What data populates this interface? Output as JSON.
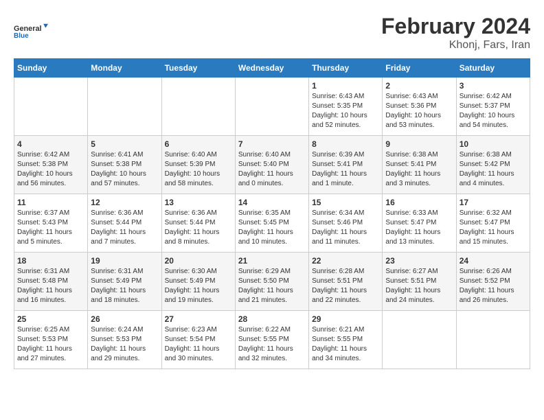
{
  "app": {
    "logo_line1": "General",
    "logo_line2": "Blue"
  },
  "title": "February 2024",
  "subtitle": "Khonj, Fars, Iran",
  "weekdays": [
    "Sunday",
    "Monday",
    "Tuesday",
    "Wednesday",
    "Thursday",
    "Friday",
    "Saturday"
  ],
  "weeks": [
    [
      {
        "day": "",
        "info": ""
      },
      {
        "day": "",
        "info": ""
      },
      {
        "day": "",
        "info": ""
      },
      {
        "day": "",
        "info": ""
      },
      {
        "day": "1",
        "info": "Sunrise: 6:43 AM\nSunset: 5:35 PM\nDaylight: 10 hours\nand 52 minutes."
      },
      {
        "day": "2",
        "info": "Sunrise: 6:43 AM\nSunset: 5:36 PM\nDaylight: 10 hours\nand 53 minutes."
      },
      {
        "day": "3",
        "info": "Sunrise: 6:42 AM\nSunset: 5:37 PM\nDaylight: 10 hours\nand 54 minutes."
      }
    ],
    [
      {
        "day": "4",
        "info": "Sunrise: 6:42 AM\nSunset: 5:38 PM\nDaylight: 10 hours\nand 56 minutes."
      },
      {
        "day": "5",
        "info": "Sunrise: 6:41 AM\nSunset: 5:38 PM\nDaylight: 10 hours\nand 57 minutes."
      },
      {
        "day": "6",
        "info": "Sunrise: 6:40 AM\nSunset: 5:39 PM\nDaylight: 10 hours\nand 58 minutes."
      },
      {
        "day": "7",
        "info": "Sunrise: 6:40 AM\nSunset: 5:40 PM\nDaylight: 11 hours\nand 0 minutes."
      },
      {
        "day": "8",
        "info": "Sunrise: 6:39 AM\nSunset: 5:41 PM\nDaylight: 11 hours\nand 1 minute."
      },
      {
        "day": "9",
        "info": "Sunrise: 6:38 AM\nSunset: 5:41 PM\nDaylight: 11 hours\nand 3 minutes."
      },
      {
        "day": "10",
        "info": "Sunrise: 6:38 AM\nSunset: 5:42 PM\nDaylight: 11 hours\nand 4 minutes."
      }
    ],
    [
      {
        "day": "11",
        "info": "Sunrise: 6:37 AM\nSunset: 5:43 PM\nDaylight: 11 hours\nand 5 minutes."
      },
      {
        "day": "12",
        "info": "Sunrise: 6:36 AM\nSunset: 5:44 PM\nDaylight: 11 hours\nand 7 minutes."
      },
      {
        "day": "13",
        "info": "Sunrise: 6:36 AM\nSunset: 5:44 PM\nDaylight: 11 hours\nand 8 minutes."
      },
      {
        "day": "14",
        "info": "Sunrise: 6:35 AM\nSunset: 5:45 PM\nDaylight: 11 hours\nand 10 minutes."
      },
      {
        "day": "15",
        "info": "Sunrise: 6:34 AM\nSunset: 5:46 PM\nDaylight: 11 hours\nand 11 minutes."
      },
      {
        "day": "16",
        "info": "Sunrise: 6:33 AM\nSunset: 5:47 PM\nDaylight: 11 hours\nand 13 minutes."
      },
      {
        "day": "17",
        "info": "Sunrise: 6:32 AM\nSunset: 5:47 PM\nDaylight: 11 hours\nand 15 minutes."
      }
    ],
    [
      {
        "day": "18",
        "info": "Sunrise: 6:31 AM\nSunset: 5:48 PM\nDaylight: 11 hours\nand 16 minutes."
      },
      {
        "day": "19",
        "info": "Sunrise: 6:31 AM\nSunset: 5:49 PM\nDaylight: 11 hours\nand 18 minutes."
      },
      {
        "day": "20",
        "info": "Sunrise: 6:30 AM\nSunset: 5:49 PM\nDaylight: 11 hours\nand 19 minutes."
      },
      {
        "day": "21",
        "info": "Sunrise: 6:29 AM\nSunset: 5:50 PM\nDaylight: 11 hours\nand 21 minutes."
      },
      {
        "day": "22",
        "info": "Sunrise: 6:28 AM\nSunset: 5:51 PM\nDaylight: 11 hours\nand 22 minutes."
      },
      {
        "day": "23",
        "info": "Sunrise: 6:27 AM\nSunset: 5:51 PM\nDaylight: 11 hours\nand 24 minutes."
      },
      {
        "day": "24",
        "info": "Sunrise: 6:26 AM\nSunset: 5:52 PM\nDaylight: 11 hours\nand 26 minutes."
      }
    ],
    [
      {
        "day": "25",
        "info": "Sunrise: 6:25 AM\nSunset: 5:53 PM\nDaylight: 11 hours\nand 27 minutes."
      },
      {
        "day": "26",
        "info": "Sunrise: 6:24 AM\nSunset: 5:53 PM\nDaylight: 11 hours\nand 29 minutes."
      },
      {
        "day": "27",
        "info": "Sunrise: 6:23 AM\nSunset: 5:54 PM\nDaylight: 11 hours\nand 30 minutes."
      },
      {
        "day": "28",
        "info": "Sunrise: 6:22 AM\nSunset: 5:55 PM\nDaylight: 11 hours\nand 32 minutes."
      },
      {
        "day": "29",
        "info": "Sunrise: 6:21 AM\nSunset: 5:55 PM\nDaylight: 11 hours\nand 34 minutes."
      },
      {
        "day": "",
        "info": ""
      },
      {
        "day": "",
        "info": ""
      }
    ]
  ]
}
